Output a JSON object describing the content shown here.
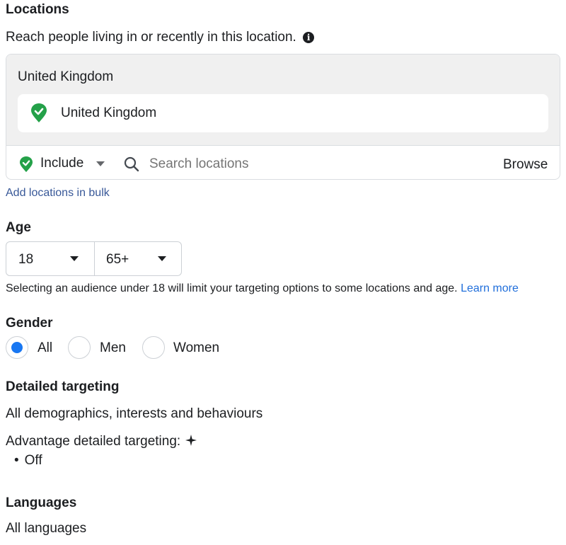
{
  "locations": {
    "heading": "Locations",
    "description": "Reach people living in or recently in this location.",
    "info_icon": "info-icon",
    "group_label": "United Kingdom",
    "selected_location": "United Kingdom",
    "include_label": "Include",
    "search_placeholder": "Search locations",
    "browse_label": "Browse",
    "bulk_link": "Add locations in bulk",
    "pin_color": "#24a149"
  },
  "age": {
    "heading": "Age",
    "min": "18",
    "max": "65+",
    "note": "Selecting an audience under 18 will limit your targeting options to some locations and age.",
    "learn_more": "Learn more"
  },
  "gender": {
    "heading": "Gender",
    "options": [
      "All",
      "Men",
      "Women"
    ],
    "selected": "All"
  },
  "detailed_targeting": {
    "heading": "Detailed targeting",
    "summary": "All demographics, interests and behaviours",
    "advantage_label": "Advantage detailed targeting:",
    "advantage_value": "Off"
  },
  "languages": {
    "heading": "Languages",
    "value": "All languages"
  },
  "accent_color": "#1877f2"
}
